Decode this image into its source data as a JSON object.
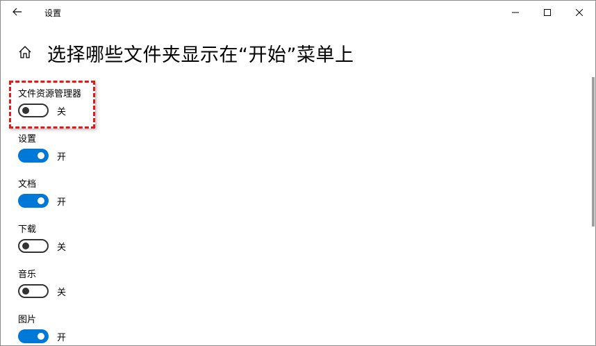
{
  "window": {
    "title": "设置",
    "controls": {
      "minimize": "minimize",
      "maximize": "maximize",
      "close": "close"
    }
  },
  "header": {
    "title": "选择哪些文件夹显示在“开始”菜单上"
  },
  "settings": [
    {
      "label": "文件资源管理器",
      "state": "关",
      "on": false
    },
    {
      "label": "设置",
      "state": "开",
      "on": true
    },
    {
      "label": "文档",
      "state": "开",
      "on": true
    },
    {
      "label": "下载",
      "state": "关",
      "on": false
    },
    {
      "label": "音乐",
      "state": "关",
      "on": false
    },
    {
      "label": "图片",
      "state": "开",
      "on": true
    }
  ],
  "colors": {
    "accent": "#0078d7",
    "highlight_border": "#e81818"
  }
}
